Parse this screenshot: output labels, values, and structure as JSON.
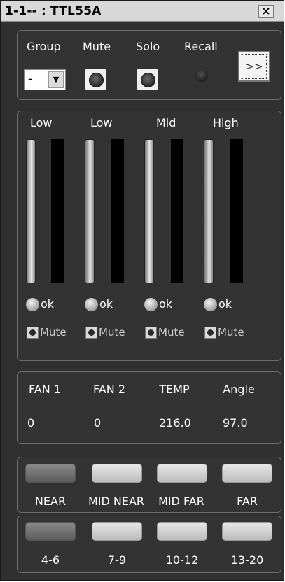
{
  "window": {
    "title": "1-1-- : TTL55A",
    "close_glyph": "×"
  },
  "controls": {
    "headers": [
      "Group",
      "Mute",
      "Solo",
      "Recall"
    ],
    "group_value": "-",
    "dropdown_arrow": "▼",
    "next_label": ">>"
  },
  "bands": [
    {
      "label": "Low",
      "status": "ok",
      "mute_label": "Mute"
    },
    {
      "label": "Low",
      "status": "ok",
      "mute_label": "Mute"
    },
    {
      "label": "Mid",
      "status": "ok",
      "mute_label": "Mute"
    },
    {
      "label": "High",
      "status": "ok",
      "mute_label": "Mute"
    }
  ],
  "readouts": {
    "labels": [
      "FAN 1",
      "FAN 2",
      "TEMP",
      "Angle"
    ],
    "values": [
      "0",
      "0",
      "216.0",
      "97.0"
    ]
  },
  "zones": {
    "labels": [
      "NEAR",
      "MID NEAR",
      "MID FAR",
      "FAR"
    ],
    "selected_index": 0
  },
  "ranges": {
    "labels": [
      "4-6",
      "7-9",
      "10-12",
      "13-20"
    ],
    "selected_index": 0
  },
  "colors": {
    "background": "#303030",
    "text": "#ffffff",
    "active_button": "#707070",
    "inactive_button": "#d2d2d2"
  }
}
